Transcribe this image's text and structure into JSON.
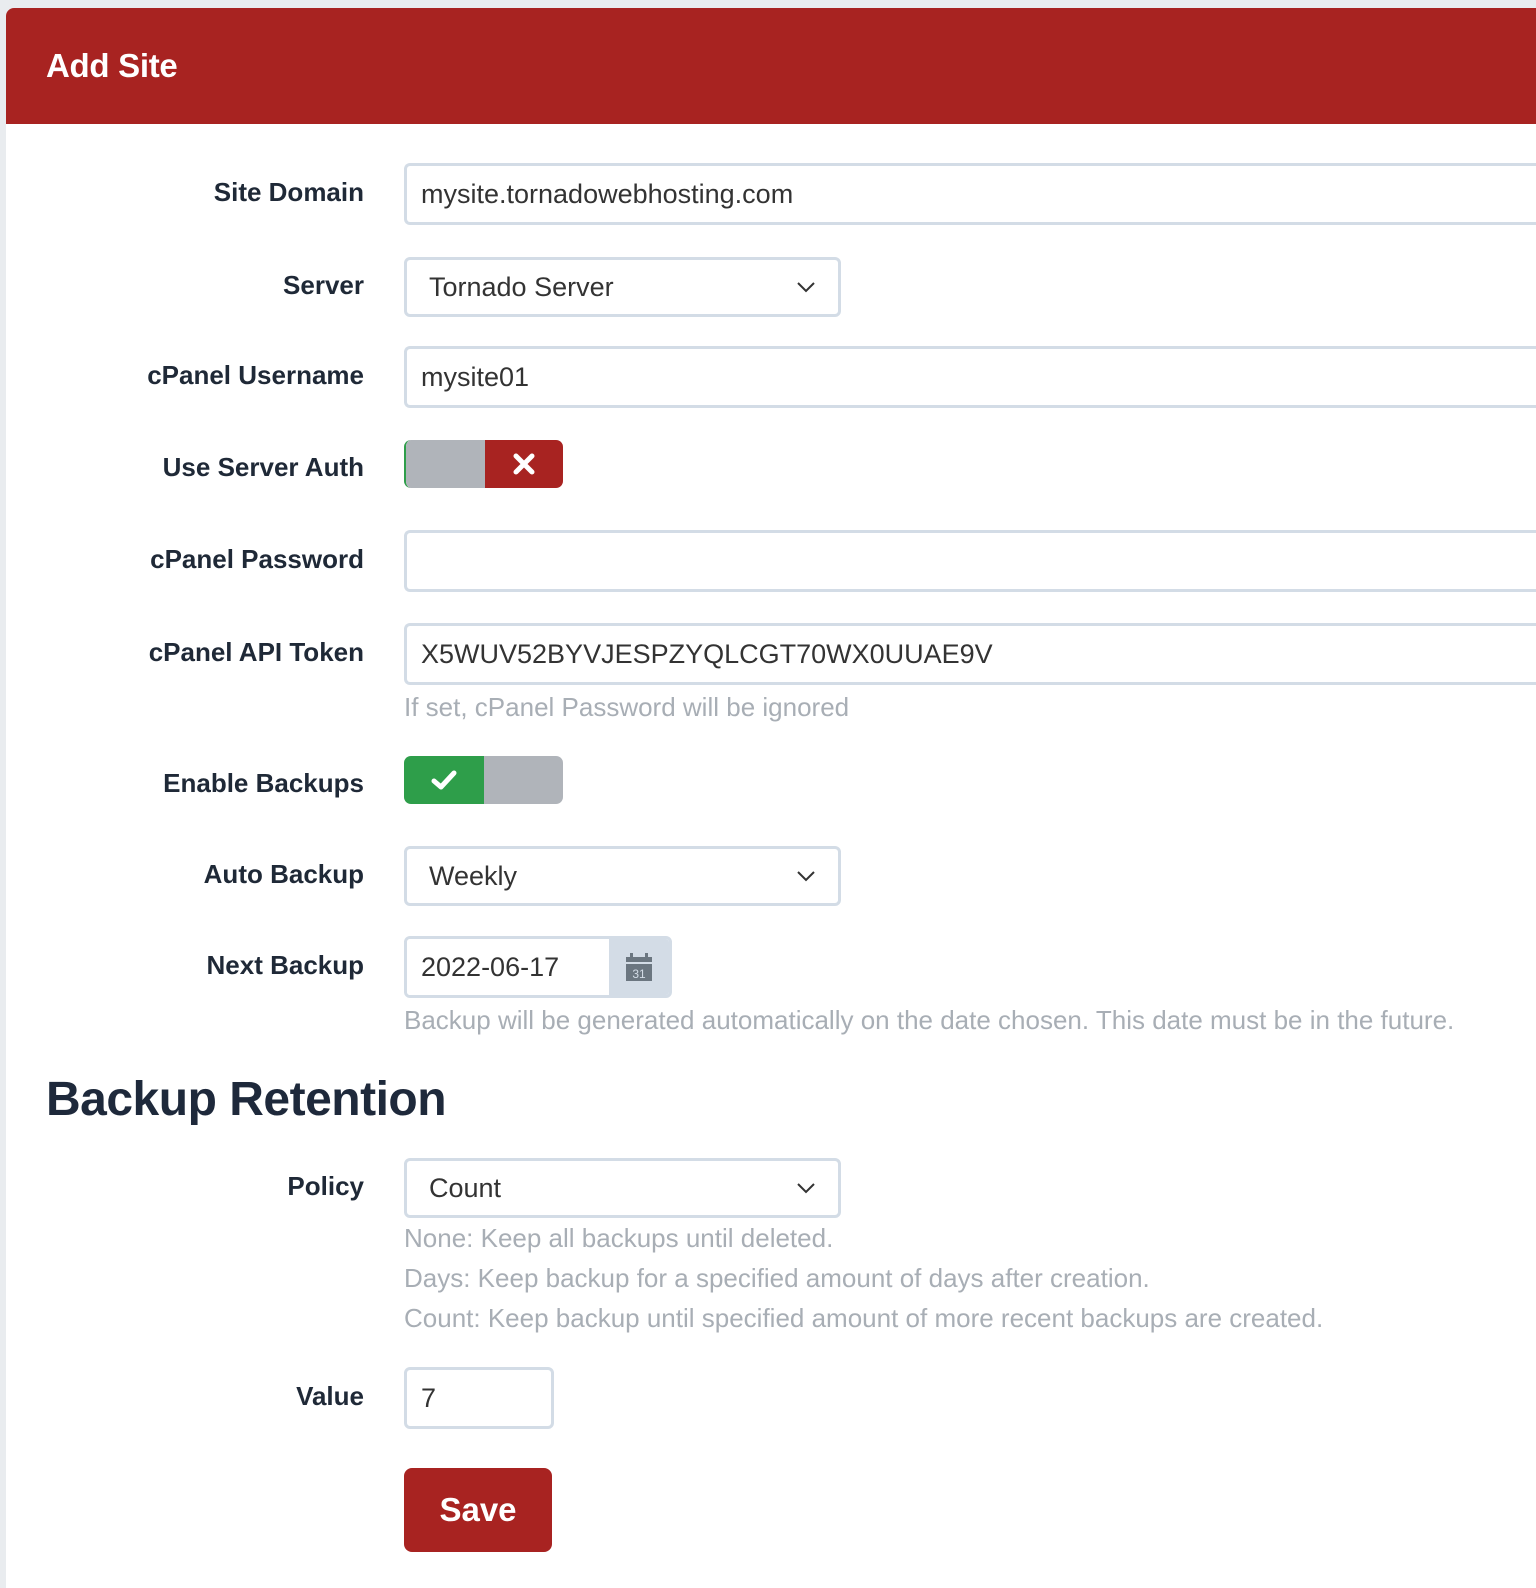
{
  "header": {
    "title": "Add Site"
  },
  "form": {
    "site_domain": {
      "label": "Site Domain",
      "value": "mysite.tornadowebhosting.com"
    },
    "server": {
      "label": "Server",
      "selected": "Tornado Server",
      "icon": "chevron-down-icon"
    },
    "cpanel_username": {
      "label": "cPanel Username",
      "value": "mysite01"
    },
    "use_server_auth": {
      "label": "Use Server Auth",
      "state": "off",
      "icon": "x-icon",
      "on_color": "#2e9e4a",
      "off_color": "#a82321"
    },
    "cpanel_password": {
      "label": "cPanel Password",
      "value": ""
    },
    "cpanel_api_token": {
      "label": "cPanel API Token",
      "value": "X5WUV52BYVJESPZYQLCGT70WX0UUAE9V",
      "help": "If set, cPanel Password will be ignored"
    },
    "enable_backups": {
      "label": "Enable Backups",
      "state": "on",
      "icon": "check-icon"
    },
    "auto_backup": {
      "label": "Auto Backup",
      "selected": "Weekly"
    },
    "next_backup": {
      "label": "Next Backup",
      "value": "2022-06-17",
      "icon": "calendar-icon",
      "icon_text": "31",
      "help": "Backup will be generated automatically on the date chosen. This date must be in the future."
    }
  },
  "retention": {
    "title": "Backup Retention",
    "policy": {
      "label": "Policy",
      "selected": "Count",
      "help": [
        "None: Keep all backups until deleted.",
        "Days: Keep backup for a specified amount of days after creation.",
        "Count: Keep backup until specified amount of more recent backups are created."
      ]
    },
    "value": {
      "label": "Value",
      "value": "7"
    }
  },
  "actions": {
    "save_label": "Save"
  },
  "colors": {
    "brand": "#a82321",
    "success": "#2e9e4a",
    "toggle_off": "#b0b4ba",
    "border": "#d3dce6"
  }
}
